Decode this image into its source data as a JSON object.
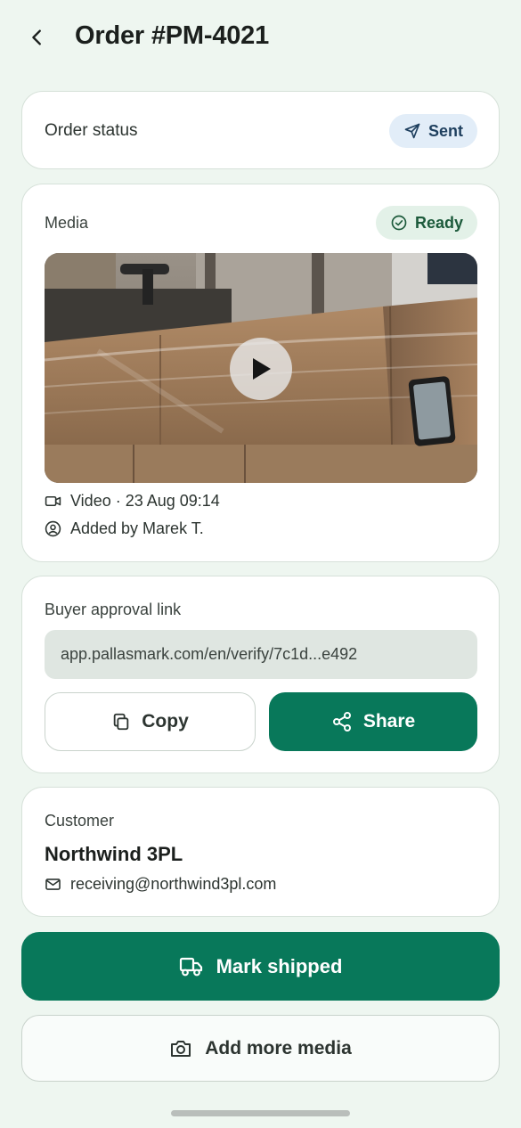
{
  "header": {
    "title": "Order #PM-4021",
    "back_icon": "chevron-left-icon"
  },
  "status_card": {
    "label": "Order status",
    "badge": "Sent",
    "badge_icon": "send-icon",
    "badge_color": "#1e3f5e"
  },
  "media_card": {
    "label": "Media",
    "badge": "Ready",
    "badge_icon": "check-circle-icon",
    "video_meta": "Video · 23 Aug 09:14",
    "added_by": "Added by Marek T.",
    "play_icon": "play-icon"
  },
  "link_card": {
    "label": "Buyer approval link",
    "url": "app.pallasmark.com/en/verify/7c1d...e492",
    "copy_label": "Copy",
    "share_label": "Share"
  },
  "customer_card": {
    "label": "Customer",
    "name": "Northwind 3PL",
    "email": "receiving@northwind3pl.com"
  },
  "actions": {
    "primary_label": "Mark shipped",
    "secondary_label": "Add more media"
  },
  "colors": {
    "accent": "#08785a",
    "background": "#eef6f0"
  }
}
